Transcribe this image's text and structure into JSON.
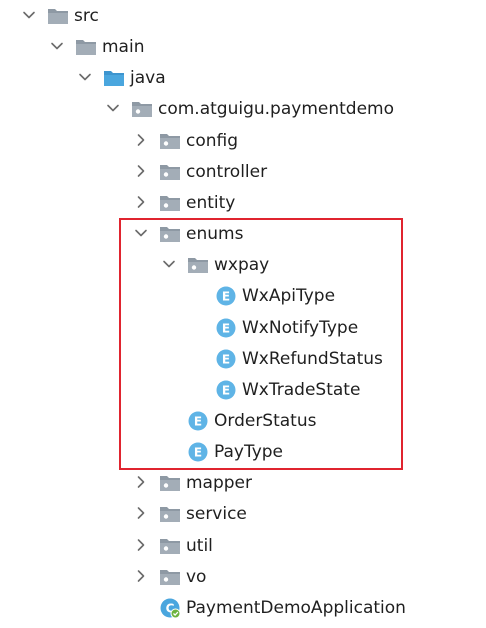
{
  "colors": {
    "highlight": "#e0242f",
    "folder_gray": "#8e99a4",
    "folder_blue": "#4aa6de",
    "enum_badge": "#5fb4e6",
    "app_class": "#4aa6de"
  },
  "tree": {
    "nodes": [
      {
        "name": "tree-node-src",
        "label": "src",
        "depth": 0,
        "expanded": true,
        "icon": "folder-icon",
        "icon_kind": "folder-gray"
      },
      {
        "name": "tree-node-main",
        "label": "main",
        "depth": 1,
        "expanded": true,
        "icon": "folder-icon",
        "icon_kind": "folder-gray"
      },
      {
        "name": "tree-node-java",
        "label": "java",
        "depth": 2,
        "expanded": true,
        "icon": "source-folder-icon",
        "icon_kind": "folder-blue"
      },
      {
        "name": "tree-node-com-atguigu-paymentdemo",
        "label": "com.atguigu.paymentdemo",
        "depth": 3,
        "expanded": true,
        "icon": "package-icon",
        "icon_kind": "package"
      },
      {
        "name": "tree-node-config",
        "label": "config",
        "depth": 4,
        "expanded": false,
        "icon": "package-icon",
        "icon_kind": "package"
      },
      {
        "name": "tree-node-controller",
        "label": "controller",
        "depth": 4,
        "expanded": false,
        "icon": "package-icon",
        "icon_kind": "package"
      },
      {
        "name": "tree-node-entity",
        "label": "entity",
        "depth": 4,
        "expanded": false,
        "icon": "package-icon",
        "icon_kind": "package"
      },
      {
        "name": "tree-node-enums",
        "label": "enums",
        "depth": 4,
        "expanded": true,
        "icon": "package-icon",
        "icon_kind": "package"
      },
      {
        "name": "tree-node-wxpay",
        "label": "wxpay",
        "depth": 5,
        "expanded": true,
        "icon": "package-icon",
        "icon_kind": "package"
      },
      {
        "name": "tree-node-wxapitype",
        "label": "WxApiType",
        "depth": 6,
        "expanded": null,
        "icon": "enum-icon",
        "icon_kind": "enum"
      },
      {
        "name": "tree-node-wxnotifytype",
        "label": "WxNotifyType",
        "depth": 6,
        "expanded": null,
        "icon": "enum-icon",
        "icon_kind": "enum"
      },
      {
        "name": "tree-node-wxrefundstatus",
        "label": "WxRefundStatus",
        "depth": 6,
        "expanded": null,
        "icon": "enum-icon",
        "icon_kind": "enum"
      },
      {
        "name": "tree-node-wxtradestate",
        "label": "WxTradeState",
        "depth": 6,
        "expanded": null,
        "icon": "enum-icon",
        "icon_kind": "enum"
      },
      {
        "name": "tree-node-orderstatus",
        "label": "OrderStatus",
        "depth": 5,
        "expanded": null,
        "icon": "enum-icon",
        "icon_kind": "enum"
      },
      {
        "name": "tree-node-paytype",
        "label": "PayType",
        "depth": 5,
        "expanded": null,
        "icon": "enum-icon",
        "icon_kind": "enum"
      },
      {
        "name": "tree-node-mapper",
        "label": "mapper",
        "depth": 4,
        "expanded": false,
        "icon": "package-icon",
        "icon_kind": "package"
      },
      {
        "name": "tree-node-service",
        "label": "service",
        "depth": 4,
        "expanded": false,
        "icon": "package-icon",
        "icon_kind": "package"
      },
      {
        "name": "tree-node-util",
        "label": "util",
        "depth": 4,
        "expanded": false,
        "icon": "package-icon",
        "icon_kind": "package"
      },
      {
        "name": "tree-node-vo",
        "label": "vo",
        "depth": 4,
        "expanded": false,
        "icon": "package-icon",
        "icon_kind": "package"
      },
      {
        "name": "tree-node-paymentdemoapplication",
        "label": "PaymentDemoApplication",
        "depth": 4,
        "expanded": null,
        "icon": "spring-boot-class-icon",
        "icon_kind": "app"
      }
    ]
  }
}
